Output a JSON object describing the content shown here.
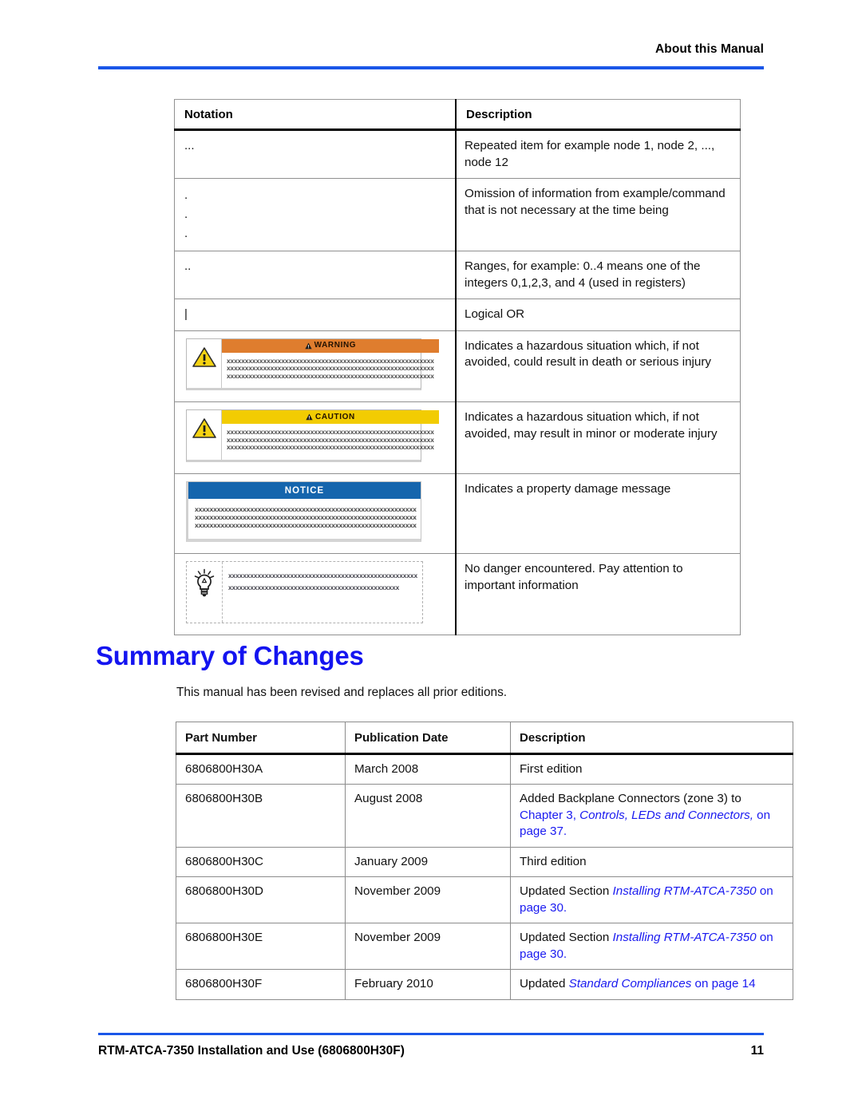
{
  "header": {
    "title": "About this Manual",
    "rule_color": "#1a56e8"
  },
  "footer": {
    "document_title": "RTM-ATCA-7350 Installation and Use (6806800H30F)",
    "page_number": "11",
    "rule_color": "#1a56e8"
  },
  "notation_table": {
    "columns": [
      "Notation",
      "Description"
    ],
    "rows": [
      {
        "notation": "...",
        "description": "Repeated item for example node 1, node 2, ..., node 12"
      },
      {
        "notation": ".\n.\n.",
        "description": "Omission of information from example/command that is not necessary at the time being"
      },
      {
        "notation": "..",
        "description": "Ranges, for example: 0..4 means one of the integers 0,1,2,3, and 4 (used in registers)"
      },
      {
        "notation": "|",
        "description": "Logical OR"
      },
      {
        "notation": "warning-box",
        "description": "Indicates a hazardous situation which, if not avoided, could result in death or serious injury"
      },
      {
        "notation": "caution-box",
        "description": "Indicates a hazardous situation which, if not avoided, may result in minor or moderate injury"
      },
      {
        "notation": "notice-box",
        "description": "Indicates a property damage message"
      },
      {
        "notation": "tip-box",
        "description": "No danger encountered. Pay attention to important information"
      }
    ]
  },
  "alerts": {
    "warning": {
      "label": "WARNING",
      "banner_color": "#df7d2e",
      "icon": "warning-triangle-icon",
      "placeholder_lines": [
        "xxxxxxxxxxxxxxxxxxxxxxxxxxxxxxxxxxxxxxxxxxxxxxxxxxxxxxxxx",
        "xxxxxxxxxxxxxxxxxxxxxxxxxxxxxxxxxxxxxxxxxxxxxxxxxxxxxxxxx",
        "xxxxxxxxxxxxxxxxxxxxxxxxxxxxxxxxxxxxxxxxxxxxxxxxxxxxxxxxx"
      ]
    },
    "caution": {
      "label": "CAUTION",
      "banner_color": "#f2cc02",
      "icon": "warning-triangle-icon",
      "placeholder_lines": [
        "xxxxxxxxxxxxxxxxxxxxxxxxxxxxxxxxxxxxxxxxxxxxxxxxxxxxxxxxx",
        "xxxxxxxxxxxxxxxxxxxxxxxxxxxxxxxxxxxxxxxxxxxxxxxxxxxxxxxxx",
        "xxxxxxxxxxxxxxxxxxxxxxxxxxxxxxxxxxxxxxxxxxxxxxxxxxxxxxxxx"
      ]
    },
    "notice": {
      "label": "NOTICE",
      "banner_color": "#1565ad",
      "placeholder_lines": [
        "xxxxxxxxxxxxxxxxxxxxxxxxxxxxxxxxxxxxxxxxxxxxxxxxxxxxxxxxxxxx",
        "xxxxxxxxxxxxxxxxxxxxxxxxxxxxxxxxxxxxxxxxxxxxxxxxxxxxxxxxxxxx",
        "xxxxxxxxxxxxxxxxxxxxxxxxxxxxxxxxxxxxxxxxxxxxxxxxxxxxxxxxxxxx"
      ]
    },
    "tip": {
      "icon": "lightbulb-icon",
      "placeholder_lines": [
        "xxxxxxxxxxxxxxxxxxxxxxxxxxxxxxxxxxxxxxxxxxxxxxxxxxxx",
        "xxxxxxxxxxxxxxxxxxxxxxxxxxxxxxxxxxxxxxxxxxxxxxx"
      ]
    }
  },
  "summary": {
    "title": "Summary of Changes",
    "intro": "This manual has been revised and replaces all prior editions."
  },
  "changes_table": {
    "columns": [
      "Part Number",
      "Publication Date",
      "Description"
    ],
    "rows": [
      {
        "part_number": "6806800H30A",
        "publication_date": "March 2008",
        "description_plain": "First edition"
      },
      {
        "part_number": "6806800H30B",
        "publication_date": "August 2008",
        "description_plain": "Added Backplane Connectors (zone 3) to",
        "description_link_prefix": "Chapter 3, ",
        "description_link_italic": "Controls, LEDs and Connectors,",
        "description_link_suffix": " on page 37."
      },
      {
        "part_number": "6806800H30C",
        "publication_date": "January 2009",
        "description_plain": "Third edition"
      },
      {
        "part_number": "6806800H30D",
        "publication_date": "November 2009",
        "description_plain": "Updated Section ",
        "description_link_italic": "Installing RTM-ATCA-7350",
        "description_link_suffix": " on page 30."
      },
      {
        "part_number": "6806800H30E",
        "publication_date": "November 2009",
        "description_plain": "Updated Section ",
        "description_link_italic": "Installing RTM-ATCA-7350",
        "description_link_suffix": " on page 30."
      },
      {
        "part_number": "6806800H30F",
        "publication_date": "February 2010",
        "description_plain": "Updated ",
        "description_link_italic": "Standard Compliances",
        "description_link_suffix": " on page 14"
      }
    ]
  }
}
